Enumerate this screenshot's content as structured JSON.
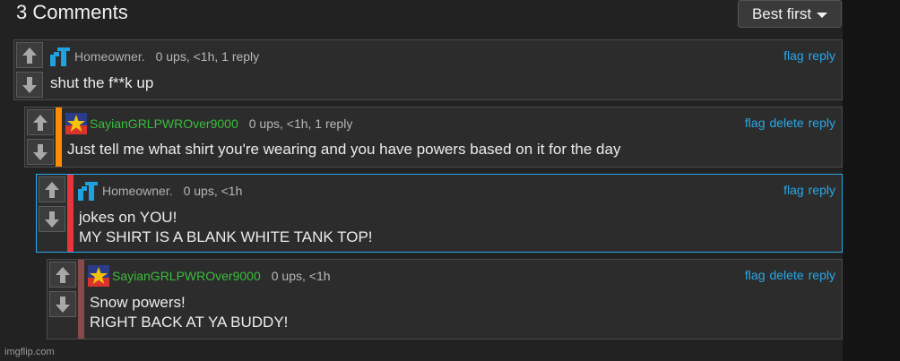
{
  "header": {
    "title": "3 Comments",
    "sort_label": "Best first"
  },
  "colors": {
    "accent_blue": "#29a8e8",
    "username_green": "#3bbd3b",
    "stripe_orange": "#ff8c00",
    "stripe_red": "#e8353b",
    "stripe_maroon": "#8a4a4a",
    "highlight_border": "#29a8e8"
  },
  "comments": [
    {
      "user": "Homeowner.",
      "stats": "0 ups, <1h, 1 reply",
      "flag": "flag",
      "reply": "reply",
      "lines": [
        "shut the f**k up"
      ]
    },
    {
      "user": "SayianGRLPWROver9000",
      "stats": "0 ups, <1h, 1 reply",
      "flag": "flag",
      "delete": "delete",
      "reply": "reply",
      "lines": [
        "Just tell me what shirt you're wearing and you have powers based on it for the day"
      ]
    },
    {
      "user": "Homeowner.",
      "stats": "0 ups, <1h",
      "flag": "flag",
      "reply": "reply",
      "lines": [
        "jokes on YOU!",
        "MY SHIRT IS A BLANK WHITE TANK TOP!"
      ]
    },
    {
      "user": "SayianGRLPWROver9000",
      "stats": "0 ups, <1h",
      "flag": "flag",
      "delete": "delete",
      "reply": "reply",
      "lines": [
        "Snow powers!",
        "RIGHT BACK AT YA BUDDY!"
      ]
    }
  ],
  "footer": {
    "watermark": "imgflip.com"
  }
}
